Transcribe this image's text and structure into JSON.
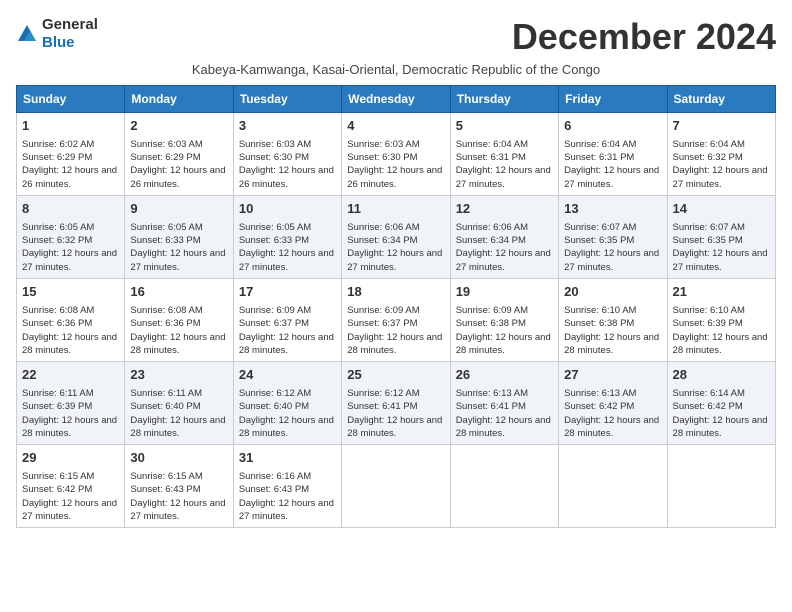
{
  "logo": {
    "general": "General",
    "blue": "Blue"
  },
  "title": "December 2024",
  "subtitle": "Kabeya-Kamwanga, Kasai-Oriental, Democratic Republic of the Congo",
  "days_of_week": [
    "Sunday",
    "Monday",
    "Tuesday",
    "Wednesday",
    "Thursday",
    "Friday",
    "Saturday"
  ],
  "weeks": [
    [
      {
        "day": "1",
        "sunrise": "6:02 AM",
        "sunset": "6:29 PM",
        "daylight": "12 hours and 26 minutes."
      },
      {
        "day": "2",
        "sunrise": "6:03 AM",
        "sunset": "6:29 PM",
        "daylight": "12 hours and 26 minutes."
      },
      {
        "day": "3",
        "sunrise": "6:03 AM",
        "sunset": "6:30 PM",
        "daylight": "12 hours and 26 minutes."
      },
      {
        "day": "4",
        "sunrise": "6:03 AM",
        "sunset": "6:30 PM",
        "daylight": "12 hours and 26 minutes."
      },
      {
        "day": "5",
        "sunrise": "6:04 AM",
        "sunset": "6:31 PM",
        "daylight": "12 hours and 27 minutes."
      },
      {
        "day": "6",
        "sunrise": "6:04 AM",
        "sunset": "6:31 PM",
        "daylight": "12 hours and 27 minutes."
      },
      {
        "day": "7",
        "sunrise": "6:04 AM",
        "sunset": "6:32 PM",
        "daylight": "12 hours and 27 minutes."
      }
    ],
    [
      {
        "day": "8",
        "sunrise": "6:05 AM",
        "sunset": "6:32 PM",
        "daylight": "12 hours and 27 minutes."
      },
      {
        "day": "9",
        "sunrise": "6:05 AM",
        "sunset": "6:33 PM",
        "daylight": "12 hours and 27 minutes."
      },
      {
        "day": "10",
        "sunrise": "6:05 AM",
        "sunset": "6:33 PM",
        "daylight": "12 hours and 27 minutes."
      },
      {
        "day": "11",
        "sunrise": "6:06 AM",
        "sunset": "6:34 PM",
        "daylight": "12 hours and 27 minutes."
      },
      {
        "day": "12",
        "sunrise": "6:06 AM",
        "sunset": "6:34 PM",
        "daylight": "12 hours and 27 minutes."
      },
      {
        "day": "13",
        "sunrise": "6:07 AM",
        "sunset": "6:35 PM",
        "daylight": "12 hours and 27 minutes."
      },
      {
        "day": "14",
        "sunrise": "6:07 AM",
        "sunset": "6:35 PM",
        "daylight": "12 hours and 27 minutes."
      }
    ],
    [
      {
        "day": "15",
        "sunrise": "6:08 AM",
        "sunset": "6:36 PM",
        "daylight": "12 hours and 28 minutes."
      },
      {
        "day": "16",
        "sunrise": "6:08 AM",
        "sunset": "6:36 PM",
        "daylight": "12 hours and 28 minutes."
      },
      {
        "day": "17",
        "sunrise": "6:09 AM",
        "sunset": "6:37 PM",
        "daylight": "12 hours and 28 minutes."
      },
      {
        "day": "18",
        "sunrise": "6:09 AM",
        "sunset": "6:37 PM",
        "daylight": "12 hours and 28 minutes."
      },
      {
        "day": "19",
        "sunrise": "6:09 AM",
        "sunset": "6:38 PM",
        "daylight": "12 hours and 28 minutes."
      },
      {
        "day": "20",
        "sunrise": "6:10 AM",
        "sunset": "6:38 PM",
        "daylight": "12 hours and 28 minutes."
      },
      {
        "day": "21",
        "sunrise": "6:10 AM",
        "sunset": "6:39 PM",
        "daylight": "12 hours and 28 minutes."
      }
    ],
    [
      {
        "day": "22",
        "sunrise": "6:11 AM",
        "sunset": "6:39 PM",
        "daylight": "12 hours and 28 minutes."
      },
      {
        "day": "23",
        "sunrise": "6:11 AM",
        "sunset": "6:40 PM",
        "daylight": "12 hours and 28 minutes."
      },
      {
        "day": "24",
        "sunrise": "6:12 AM",
        "sunset": "6:40 PM",
        "daylight": "12 hours and 28 minutes."
      },
      {
        "day": "25",
        "sunrise": "6:12 AM",
        "sunset": "6:41 PM",
        "daylight": "12 hours and 28 minutes."
      },
      {
        "day": "26",
        "sunrise": "6:13 AM",
        "sunset": "6:41 PM",
        "daylight": "12 hours and 28 minutes."
      },
      {
        "day": "27",
        "sunrise": "6:13 AM",
        "sunset": "6:42 PM",
        "daylight": "12 hours and 28 minutes."
      },
      {
        "day": "28",
        "sunrise": "6:14 AM",
        "sunset": "6:42 PM",
        "daylight": "12 hours and 28 minutes."
      }
    ],
    [
      {
        "day": "29",
        "sunrise": "6:15 AM",
        "sunset": "6:42 PM",
        "daylight": "12 hours and 27 minutes."
      },
      {
        "day": "30",
        "sunrise": "6:15 AM",
        "sunset": "6:43 PM",
        "daylight": "12 hours and 27 minutes."
      },
      {
        "day": "31",
        "sunrise": "6:16 AM",
        "sunset": "6:43 PM",
        "daylight": "12 hours and 27 minutes."
      },
      null,
      null,
      null,
      null
    ]
  ],
  "labels": {
    "sunrise_prefix": "Sunrise: ",
    "sunset_prefix": "Sunset: ",
    "daylight_prefix": "Daylight: "
  }
}
